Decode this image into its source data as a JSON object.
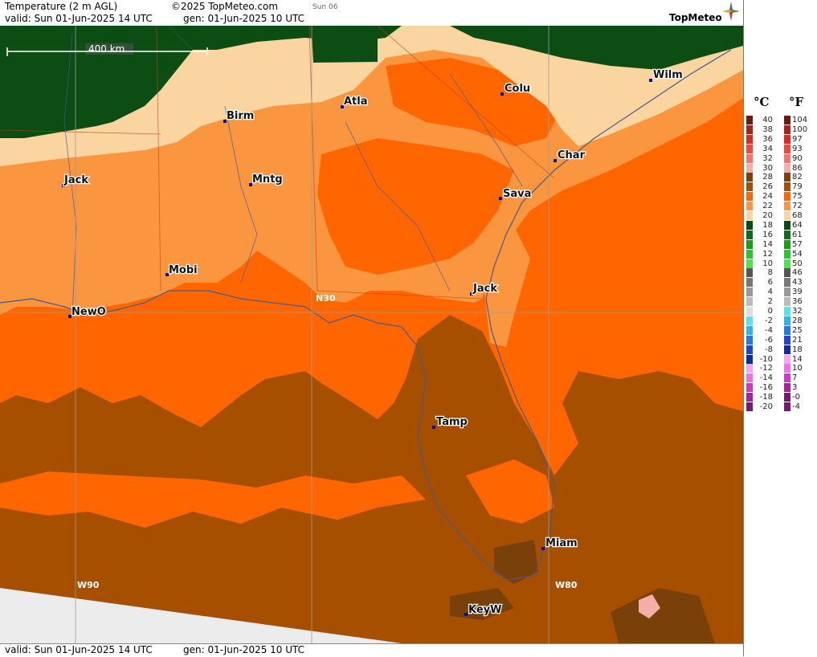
{
  "header": {
    "title": "Temperature (2 m AGL)",
    "copyright": "©2025 TopMeteo.com",
    "day": "Sun 06",
    "valid": "valid:  Sun  01-Jun-2025  14 UTC",
    "gen": "gen: 01-Jun-2025 10 UTC",
    "logo": "TopMeteo"
  },
  "footer": {
    "valid": "valid:  Sun  01-Jun-2025  14 UTC",
    "gen": "gen: 01-Jun-2025 10 UTC"
  },
  "scale_bar": {
    "label": "400 km"
  },
  "cities": [
    {
      "key": "birm",
      "label": "Birm"
    },
    {
      "key": "atla",
      "label": "Atla"
    },
    {
      "key": "colu",
      "label": "Colu"
    },
    {
      "key": "wilm",
      "label": "Wilm"
    },
    {
      "key": "char",
      "label": "Char"
    },
    {
      "key": "sava",
      "label": "Sava"
    },
    {
      "key": "jackms",
      "label": "Jack"
    },
    {
      "key": "mntg",
      "label": "Mntg"
    },
    {
      "key": "mobi",
      "label": "Mobi"
    },
    {
      "key": "newo",
      "label": "NewO"
    },
    {
      "key": "jackfl",
      "label": "Jack"
    },
    {
      "key": "tamp",
      "label": "Tamp"
    },
    {
      "key": "miam",
      "label": "Miam"
    },
    {
      "key": "keyw",
      "label": "KeyW"
    }
  ],
  "grid_labels": {
    "lat": "N30",
    "lon_w90": "W90",
    "lon_w80": "W80"
  },
  "legend": {
    "unit_c": "°C",
    "unit_f": "°F",
    "rows": [
      {
        "c": "40",
        "f": "104",
        "cc": "#6b1b0f",
        "fc": "#6b1b0f"
      },
      {
        "c": "38",
        "f": "100",
        "cc": "#a3261a",
        "fc": "#a3261a"
      },
      {
        "c": "36",
        "f": "97",
        "cc": "#d62c24",
        "fc": "#d62c24"
      },
      {
        "c": "34",
        "f": "93",
        "cc": "#f0463b",
        "fc": "#f0463b"
      },
      {
        "c": "32",
        "f": "90",
        "cc": "#f5746c",
        "fc": "#f5746c"
      },
      {
        "c": "30",
        "f": "86",
        "cc": "#f4b0a6",
        "fc": "#f4b0a6"
      },
      {
        "c": "28",
        "f": "82",
        "cc": "#7a4009",
        "fc": "#7a4009"
      },
      {
        "c": "26",
        "f": "79",
        "cc": "#a64f00",
        "fc": "#a64f00"
      },
      {
        "c": "24",
        "f": "75",
        "cc": "#ff6600",
        "fc": "#ff6600"
      },
      {
        "c": "22",
        "f": "72",
        "cc": "#fa9540",
        "fc": "#fa9540"
      },
      {
        "c": "20",
        "f": "68",
        "cc": "#fad5a0",
        "fc": "#fad5a0"
      },
      {
        "c": "18",
        "f": "64",
        "cc": "#0a4a12",
        "fc": "#0a4a12"
      },
      {
        "c": "16",
        "f": "61",
        "cc": "#0c6e17",
        "fc": "#0c6e17"
      },
      {
        "c": "14",
        "f": "57",
        "cc": "#14a01f",
        "fc": "#14a01f"
      },
      {
        "c": "12",
        "f": "54",
        "cc": "#26c82c",
        "fc": "#26c82c"
      },
      {
        "c": "10",
        "f": "50",
        "cc": "#4de34d",
        "fc": "#4de34d"
      },
      {
        "c": "8",
        "f": "46",
        "cc": "#555555",
        "fc": "#555555"
      },
      {
        "c": "6",
        "f": "43",
        "cc": "#777777",
        "fc": "#777777"
      },
      {
        "c": "4",
        "f": "39",
        "cc": "#999999",
        "fc": "#999999"
      },
      {
        "c": "2",
        "f": "36",
        "cc": "#bbbbbb",
        "fc": "#bbbbbb"
      },
      {
        "c": "0",
        "f": "32",
        "cc": "#dddddd",
        "fc": "#5ce0f0"
      },
      {
        "c": "-2",
        "f": "28",
        "cc": "#5ce0f0",
        "fc": "#39b0ea"
      },
      {
        "c": "-4",
        "f": "25",
        "cc": "#39b0ea",
        "fc": "#2b78e0"
      },
      {
        "c": "-6",
        "f": "21",
        "cc": "#2b78e0",
        "fc": "#1f48c8"
      },
      {
        "c": "-8",
        "f": "18",
        "cc": "#1f48c8",
        "fc": "#0f2a9a"
      },
      {
        "c": "-10",
        "f": "14",
        "cc": "#0f2a9a",
        "fc": "#f5a8f0"
      },
      {
        "c": "-12",
        "f": "10",
        "cc": "#f5a8f0",
        "fc": "#ee6fe8"
      },
      {
        "c": "-14",
        "f": "7",
        "cc": "#ee6fe8",
        "fc": "#d436c8"
      },
      {
        "c": "-16",
        "f": "3",
        "cc": "#d436c8",
        "fc": "#a8209e"
      },
      {
        "c": "-18",
        "f": "-0",
        "cc": "#a8209e",
        "fc": "#7a1676"
      },
      {
        "c": "-20",
        "f": "-4",
        "cc": "#7a1676",
        "fc": "#7a1676"
      }
    ]
  },
  "colors": {
    "t18": "#0b4d12",
    "t20": "#fad5a0",
    "t22": "#fa9540",
    "t24": "#ff6600",
    "t26": "#a64f00",
    "t28": "#7a4009",
    "t30": "#f4b0a6",
    "nodata": "#ececec"
  }
}
